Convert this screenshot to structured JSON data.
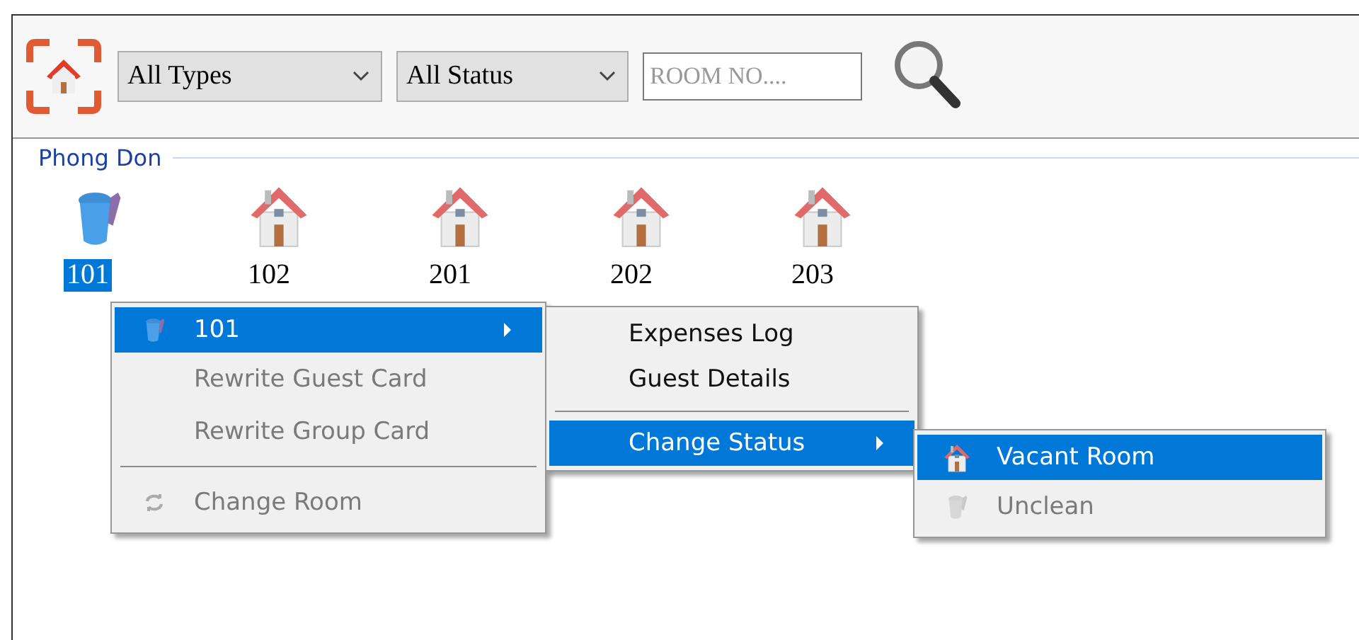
{
  "toolbar": {
    "type_filter": "All Types",
    "status_filter": "All Status",
    "room_search": {
      "placeholder": "ROOM NO...."
    }
  },
  "group": {
    "title": "Phong Don",
    "rooms": [
      {
        "number": "101",
        "kind": "unclean",
        "selected": true
      },
      {
        "number": "102",
        "kind": "vacant",
        "selected": false
      },
      {
        "number": "201",
        "kind": "vacant",
        "selected": false
      },
      {
        "number": "202",
        "kind": "vacant",
        "selected": false
      },
      {
        "number": "203",
        "kind": "vacant",
        "selected": false
      }
    ]
  },
  "menus": [
    {
      "items": [
        {
          "kind": "unclean",
          "label": "101",
          "submenu": true,
          "selected": true,
          "disabled": false
        },
        {
          "kind": "plain",
          "label": "Rewrite Guest Card",
          "selected": false,
          "disabled": true
        },
        {
          "kind": "plain",
          "label": "Rewrite Group Card",
          "selected": false,
          "disabled": true
        },
        {
          "kind": "separator"
        },
        {
          "kind": "swap",
          "label": "Change Room",
          "selected": false,
          "disabled": true
        }
      ]
    },
    {
      "items": [
        {
          "kind": "plain",
          "label": "Expenses Log",
          "selected": false,
          "disabled": false
        },
        {
          "kind": "plain",
          "label": "Guest Details",
          "selected": false,
          "disabled": false
        },
        {
          "kind": "separator"
        },
        {
          "kind": "plain",
          "label": "Change Status",
          "submenu": true,
          "selected": true,
          "disabled": false
        }
      ]
    },
    {
      "items": [
        {
          "kind": "vacant",
          "label": "Vacant Room",
          "selected": true,
          "disabled": false
        },
        {
          "kind": "unclean",
          "label": "Unclean",
          "selected": false,
          "disabled": true
        }
      ]
    }
  ]
}
